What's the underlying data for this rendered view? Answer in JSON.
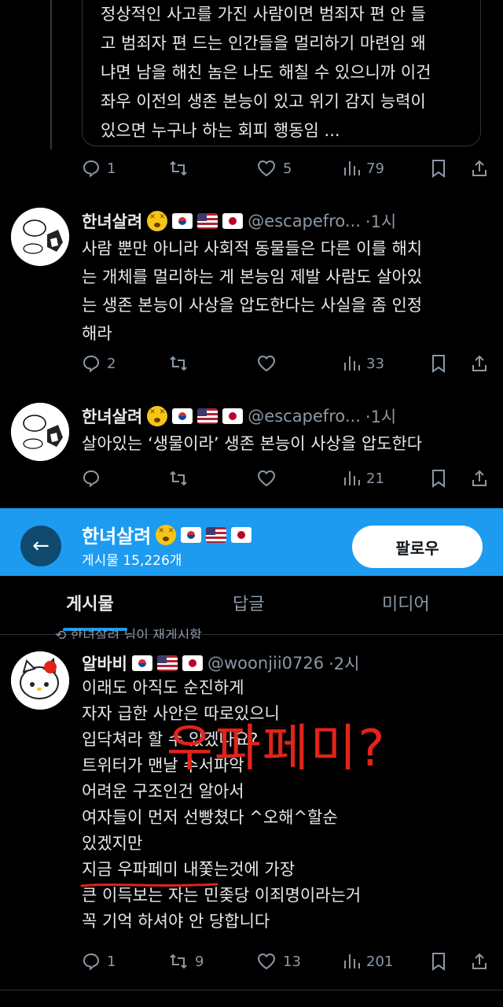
{
  "quoted": {
    "lines": [
      "정상적인 사고를 가진 사람이면 범죄자 편 안 들",
      "고 범죄자 편 드는 인간들을 멀리하기 마련임 왜",
      "냐면 남을 해친 놈은 나도 해칠 수 있으니까 이건",
      "좌우 이전의 생존 본능이 있고 위기 감지 능력이",
      "있으면 누구나 하는 회피 행동임 ..."
    ]
  },
  "tweet0_actions": {
    "replies": "1",
    "retweets": "",
    "likes": "5",
    "views": "79"
  },
  "tweet1": {
    "name": "한녀살려",
    "handle": "@escapefro...",
    "time": "·1시",
    "lines": [
      "사람 뿐만 아니라 사회적 동물들은 다른 이를 해치",
      "는 개체를 멀리하는 게 본능임 제발 사람도 살아있",
      "는 생존 본능이 사상을 압도한다는 사실을 좀 인정",
      "해라"
    ],
    "actions": {
      "replies": "2",
      "retweets": "",
      "likes": "",
      "views": "33"
    }
  },
  "tweet2": {
    "name": "한녀살려",
    "handle": "@escapefro...",
    "time": "·1시",
    "text": "살아있는 ‘생물이라’ 생존 본능이 사상을 압도한다",
    "actions": {
      "replies": "",
      "retweets": "",
      "likes": "",
      "views": "21"
    }
  },
  "profile_bar": {
    "name": "한녀살려",
    "posts_count": "게시물 15,226개",
    "follow_label": "팔로우",
    "back_icon": "arrow-left-icon",
    "bg_color": "#1d9bf0"
  },
  "tabs": [
    {
      "label": "게시물",
      "active": true
    },
    {
      "label": "답글",
      "active": false
    },
    {
      "label": "미디어",
      "active": false
    }
  ],
  "repost_banner": "한녀살려 님이 재게시함",
  "tweet3": {
    "name": "알바비",
    "handle": "@woonjii0726",
    "time": "·2시",
    "lines": [
      "이래도 아직도 순진하게",
      "자자 급한 사안은 따로있으니",
      "입닥쳐라 할 수 있겠나요?",
      "트위터가 맨날 수서파악",
      "어려운 구조인건 알아서",
      "여자들이 먼저 선빵쳤다 ^오해^할순",
      "있겠지만",
      "지금 우파페미 내쫓는것에 가장",
      "큰 이득보는 자는 민좆당 이죄명이라는거",
      "꼭 기억 하셔야 안 당합니다"
    ],
    "actions": {
      "replies": "1",
      "retweets": "9",
      "likes": "13",
      "views": "201"
    }
  },
  "annotation": {
    "text": "우파페미?",
    "color": "#e2231a"
  }
}
